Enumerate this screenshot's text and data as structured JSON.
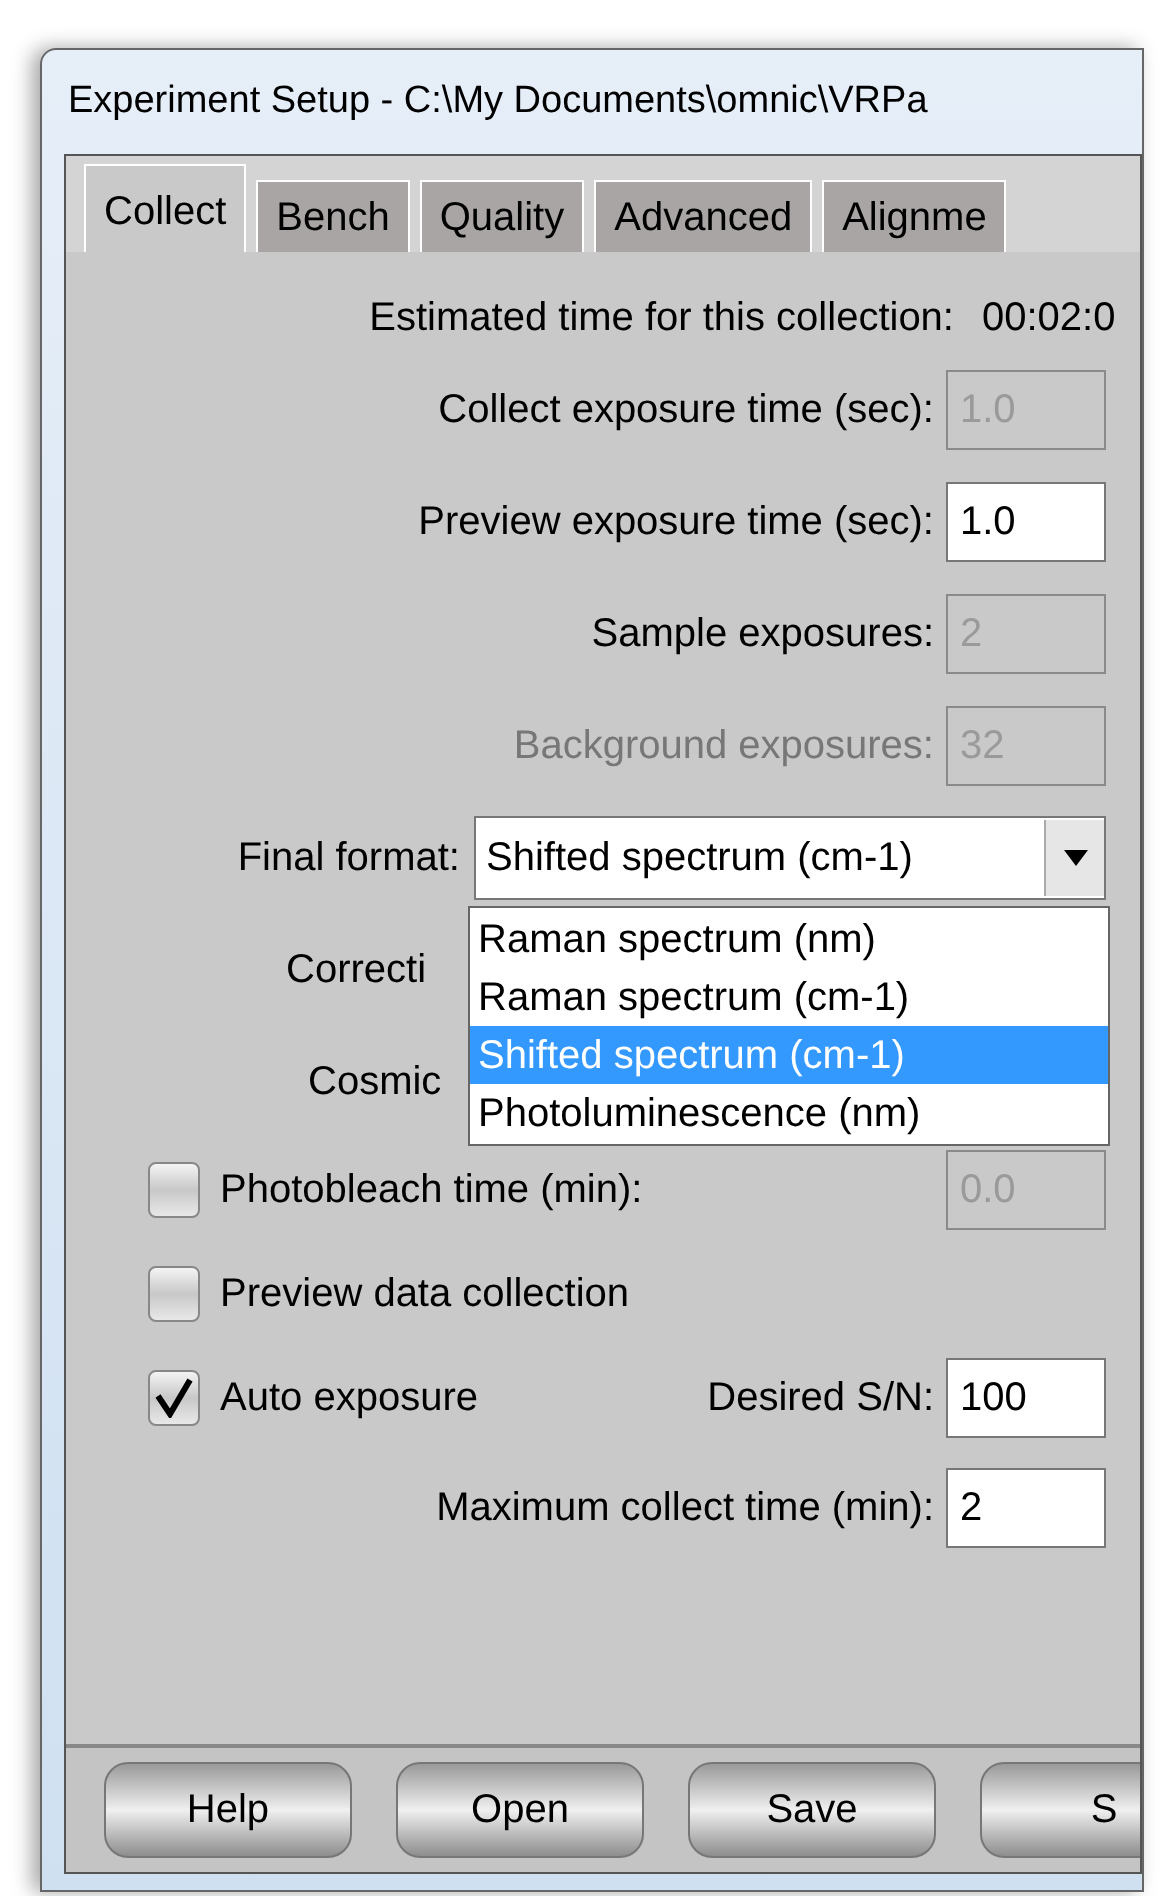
{
  "window": {
    "title": "Experiment Setup - C:\\My Documents\\omnic\\VRPa"
  },
  "tabs": [
    {
      "label": "Collect",
      "selected": true
    },
    {
      "label": "Bench",
      "selected": false
    },
    {
      "label": "Quality",
      "selected": false
    },
    {
      "label": "Advanced",
      "selected": false
    },
    {
      "label": "Alignme",
      "selected": false
    }
  ],
  "estimate": {
    "label": "Estimated time for this collection:",
    "value": "00:02:0"
  },
  "fields": [
    {
      "label": "Collect exposure time (sec):",
      "value": "1.0",
      "disabled": true,
      "label_disabled": false
    },
    {
      "label": "Preview exposure time (sec):",
      "value": "1.0",
      "disabled": false,
      "label_disabled": false
    },
    {
      "label": "Sample exposures:",
      "value": "2",
      "disabled": true,
      "label_disabled": false
    },
    {
      "label": "Background exposures:",
      "value": "32",
      "disabled": true,
      "label_disabled": true
    }
  ],
  "final_format": {
    "label": "Final format:",
    "value": "Shifted spectrum (cm-1)",
    "expanded": true,
    "options": [
      {
        "label": "Raman spectrum (nm)",
        "selected": false
      },
      {
        "label": "Raman spectrum (cm-1)",
        "selected": false
      },
      {
        "label": "Shifted spectrum (cm-1)",
        "selected": true
      },
      {
        "label": "Photoluminescence (nm)",
        "selected": false
      }
    ]
  },
  "covered_labels": [
    "Correcti",
    "Cosmic"
  ],
  "options": [
    {
      "kind": "checkbox-field",
      "label": "Photobleach time (min):",
      "checked": false,
      "value": "0.0",
      "disabled": true
    },
    {
      "kind": "checkbox",
      "label": "Preview data collection",
      "checked": false
    },
    {
      "kind": "checkbox-pair",
      "label": "Auto exposure",
      "checked": true,
      "field_label": "Desired S/N:",
      "value": "100",
      "disabled": false
    }
  ],
  "max_time": {
    "label": "Maximum collect time (min):",
    "value": "2"
  },
  "buttons": [
    "Help",
    "Open",
    "Save",
    "S"
  ]
}
